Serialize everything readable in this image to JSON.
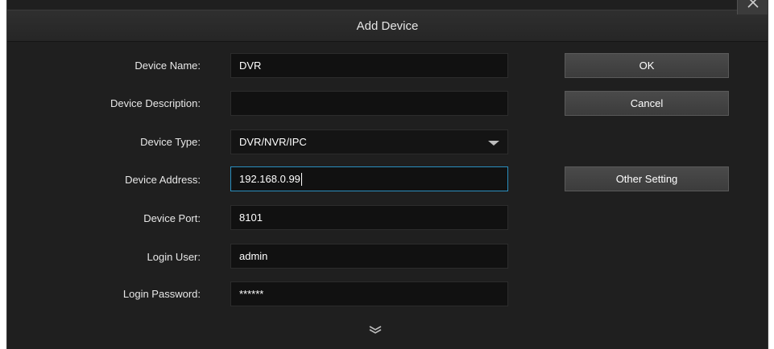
{
  "dialog": {
    "title": "Add Device",
    "close_icon": "close-icon"
  },
  "form": {
    "device_name": {
      "label": "Device Name:",
      "value": "DVR"
    },
    "device_description": {
      "label": "Device Description:",
      "value": ""
    },
    "device_type": {
      "label": "Device Type:",
      "value": "DVR/NVR/IPC",
      "icon": "chevron-down-icon"
    },
    "device_address": {
      "label": "Device Address:",
      "value": "192.168.0.99"
    },
    "device_port": {
      "label": "Device Port:",
      "value": "8101"
    },
    "login_user": {
      "label": "Login User:",
      "value": "admin"
    },
    "login_password": {
      "label": "Login Password:",
      "value": "******"
    }
  },
  "buttons": {
    "ok": "OK",
    "cancel": "Cancel",
    "other_setting": "Other Setting"
  },
  "footer": {
    "expand_icon": "double-chevron-down-icon"
  },
  "colors": {
    "background": "#1f1f1f",
    "field_background": "#111111",
    "focus_border": "#2a8fbf",
    "button_background": "#444444",
    "text": "#e8e8e8"
  }
}
